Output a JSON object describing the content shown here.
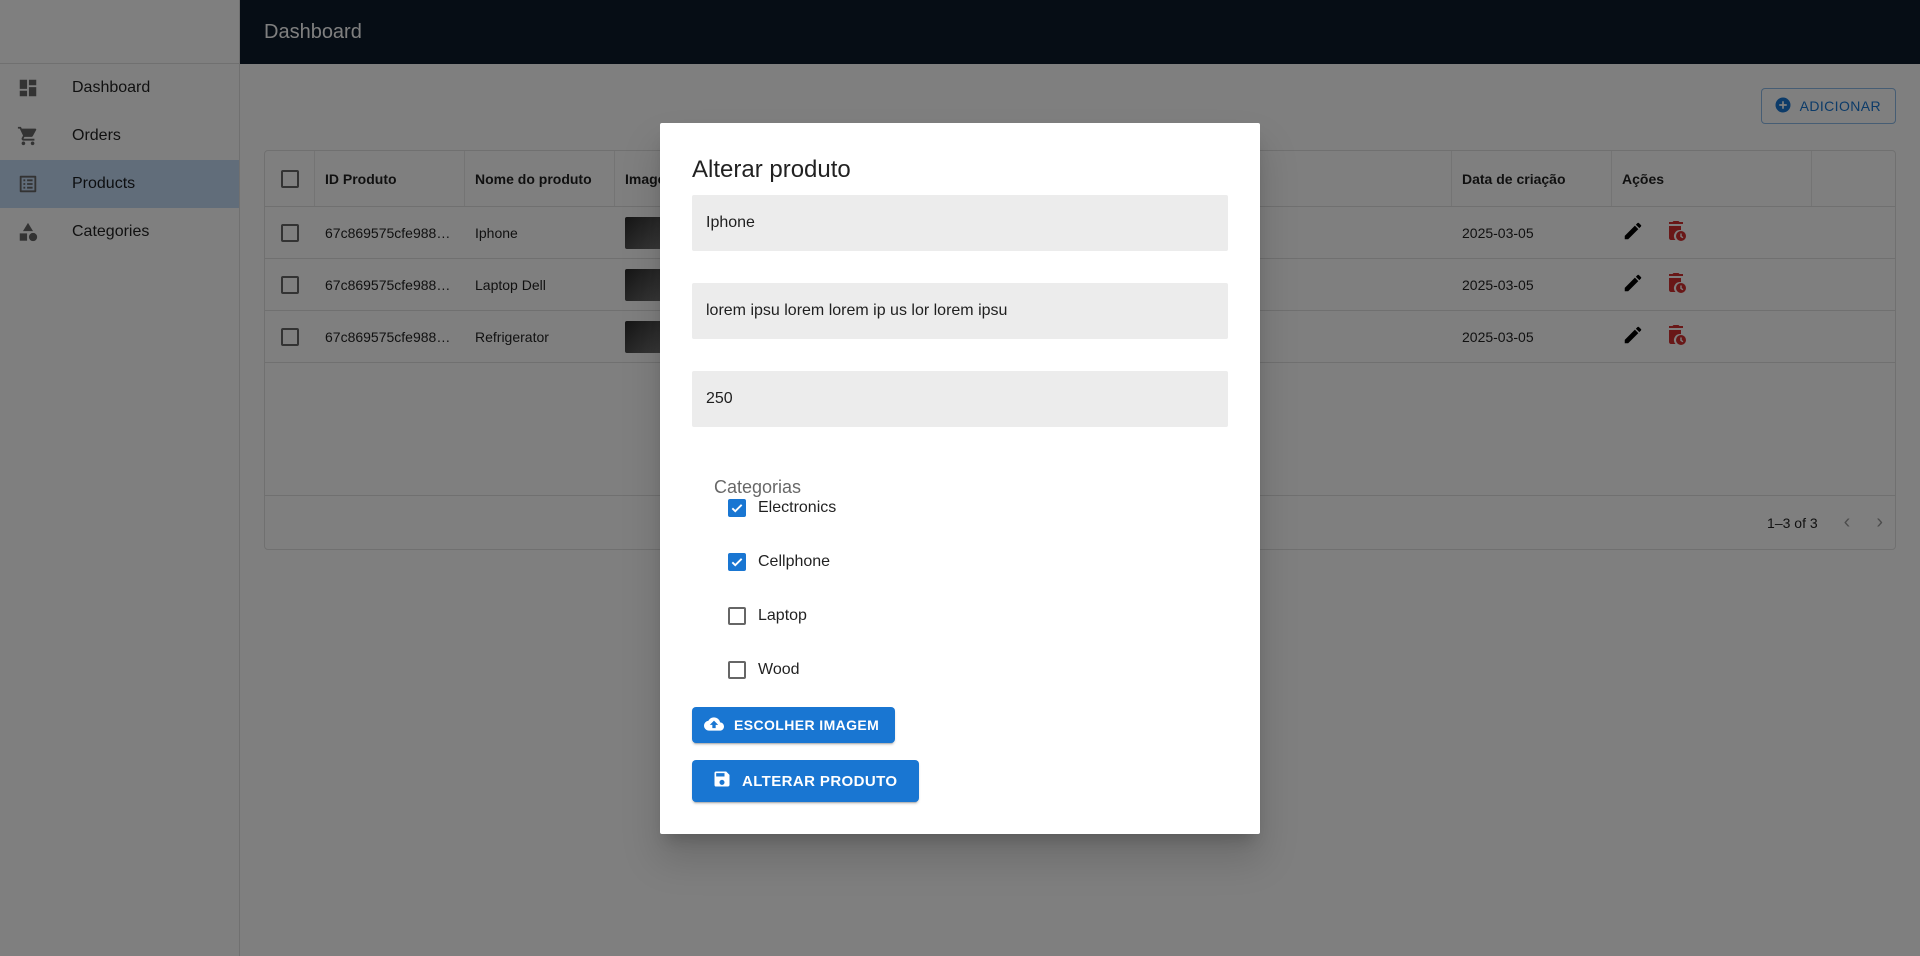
{
  "colors": {
    "primary": "#1976d2",
    "appbar": "#0d1b2a",
    "delete": "#d32f2f",
    "selected_nav": "#c3daf5"
  },
  "appbar": {
    "title": "Dashboard"
  },
  "sidebar": {
    "items": [
      {
        "label": "Dashboard",
        "icon": "dashboard-icon"
      },
      {
        "label": "Orders",
        "icon": "cart-icon"
      },
      {
        "label": "Products",
        "icon": "list-icon",
        "selected": true
      },
      {
        "label": "Categories",
        "icon": "category-icon"
      }
    ]
  },
  "main": {
    "add_label": "ADICIONAR",
    "table": {
      "headers": {
        "id": "ID Produto",
        "name": "Nome do produto",
        "image": "Image",
        "date": "Data de criação",
        "actions": "Ações"
      },
      "rows": [
        {
          "id": "67c869575cfe988…",
          "name": "Iphone",
          "date": "2025-03-05"
        },
        {
          "id": "67c869575cfe988…",
          "name": "Laptop Dell",
          "date": "2025-03-05"
        },
        {
          "id": "67c869575cfe988…",
          "name": "Refrigerator",
          "date": "2025-03-05"
        }
      ],
      "pagination": "1–3 of 3"
    }
  },
  "dialog": {
    "title": "Alterar produto",
    "name_value": "Iphone",
    "description_value": "lorem ipsu lorem lorem ip us lor lorem ipsu",
    "price_value": "250",
    "categories_label": "Categorias",
    "categories": [
      {
        "label": "Electronics",
        "checked": true
      },
      {
        "label": "Cellphone",
        "checked": true
      },
      {
        "label": "Laptop",
        "checked": false
      },
      {
        "label": "Wood",
        "checked": false
      }
    ],
    "upload_label": "ESCOLHER IMAGEM",
    "save_label": "ALTERAR PRODUTO"
  }
}
